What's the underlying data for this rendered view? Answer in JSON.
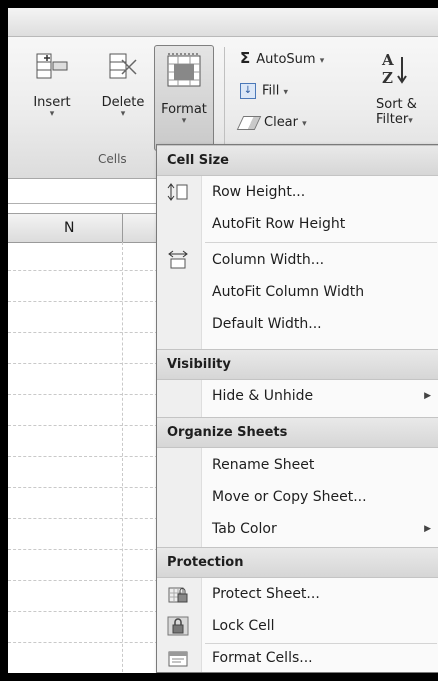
{
  "ribbon": {
    "buttons": [
      {
        "label": "Insert",
        "arrow": "▾"
      },
      {
        "label": "Delete",
        "arrow": "▾"
      },
      {
        "label": "Format",
        "arrow": "▾"
      }
    ],
    "group_label": "Cells",
    "editing": {
      "autosum": "AutoSum",
      "fill": "Fill",
      "clear": "Clear",
      "sort_line1": "Sort &",
      "sort_line2": "Filter",
      "dropdown": "▾"
    }
  },
  "sheet": {
    "column_header": "N"
  },
  "menu": {
    "sections": {
      "cell_size": "Cell Size",
      "visibility": "Visibility",
      "organize": "Organize Sheets",
      "protection": "Protection"
    },
    "items": {
      "row_height": "Row Height...",
      "autofit_row": "AutoFit Row Height",
      "column_width": "Column Width...",
      "autofit_column": "AutoFit Column Width",
      "default_width": "Default Width...",
      "hide_unhide": "Hide & Unhide",
      "rename_sheet": "Rename Sheet",
      "move_copy": "Move or Copy Sheet...",
      "tab_color": "Tab Color",
      "protect_sheet": "Protect Sheet...",
      "lock_cell": "Lock Cell",
      "format_cells": "Format Cells..."
    },
    "submenu_arrow": "▶"
  }
}
